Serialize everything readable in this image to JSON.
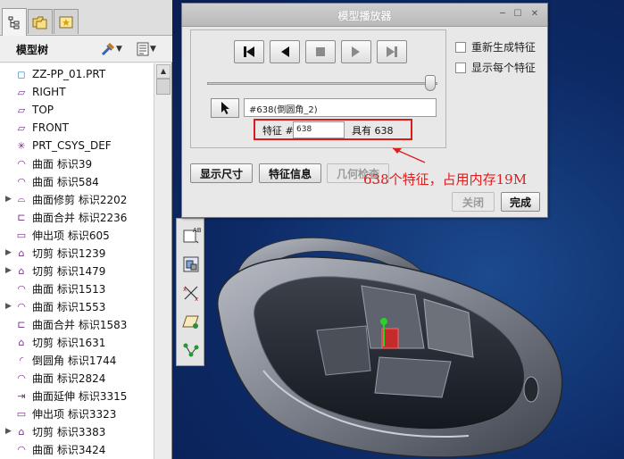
{
  "left_panel": {
    "tabs": [
      {
        "icon": "model-tree-tab-icon"
      },
      {
        "icon": "folder-browser-tab-icon"
      },
      {
        "icon": "favorites-tab-icon"
      }
    ],
    "tree_title": "模型树",
    "tree_items": [
      {
        "label": "ZZ-PP_01.PRT",
        "icon": "part-icon",
        "expand": false
      },
      {
        "label": "RIGHT",
        "icon": "datum-plane-icon",
        "expand": false
      },
      {
        "label": "TOP",
        "icon": "datum-plane-icon",
        "expand": false
      },
      {
        "label": "FRONT",
        "icon": "datum-plane-icon",
        "expand": false
      },
      {
        "label": "PRT_CSYS_DEF",
        "icon": "csys-icon",
        "expand": false
      },
      {
        "label": "曲面 标识39",
        "icon": "surface-icon",
        "expand": false
      },
      {
        "label": "曲面 标识584",
        "icon": "surface-icon",
        "expand": false
      },
      {
        "label": "曲面修剪 标识2202",
        "icon": "surface-trim-icon",
        "expand": true
      },
      {
        "label": "曲面合并 标识2236",
        "icon": "surface-merge-icon",
        "expand": false
      },
      {
        "label": "伸出项 标识605",
        "icon": "protrusion-icon",
        "expand": false
      },
      {
        "label": "切剪 标识1239",
        "icon": "cut-icon",
        "expand": true
      },
      {
        "label": "切剪 标识1479",
        "icon": "cut-icon",
        "expand": true
      },
      {
        "label": "曲面 标识1513",
        "icon": "surface-icon",
        "expand": false
      },
      {
        "label": "曲面 标识1553",
        "icon": "surface-icon",
        "expand": true
      },
      {
        "label": "曲面合并 标识1583",
        "icon": "surface-merge-icon",
        "expand": false
      },
      {
        "label": "切剪 标识1631",
        "icon": "cut-icon",
        "expand": false
      },
      {
        "label": "倒圆角 标识1744",
        "icon": "round-icon",
        "expand": false
      },
      {
        "label": "曲面 标识2824",
        "icon": "surface-icon",
        "expand": false
      },
      {
        "label": "曲面延伸 标识3315",
        "icon": "surface-extend-icon",
        "expand": false
      },
      {
        "label": "伸出项 标识3323",
        "icon": "protrusion-icon",
        "expand": false
      },
      {
        "label": "切剪 标识3383",
        "icon": "cut-icon",
        "expand": true
      },
      {
        "label": "曲面 标识3424",
        "icon": "surface-icon",
        "expand": false
      }
    ]
  },
  "dialog": {
    "title": "模型播放器",
    "player_buttons": [
      {
        "name": "first-feature-button",
        "icon": "skip-to-start-icon"
      },
      {
        "name": "step-back-button",
        "icon": "play-reverse-icon"
      },
      {
        "name": "stop-button",
        "icon": "stop-icon"
      },
      {
        "name": "step-forward-button",
        "icon": "play-icon"
      },
      {
        "name": "last-feature-button",
        "icon": "skip-to-end-icon"
      }
    ],
    "slider_position": 1.0,
    "feature_name": "#638(倒圆角_2)",
    "feature_label": "特征 #",
    "feature_number": "638",
    "total_label": "具有 638",
    "checkboxes": [
      {
        "label": "重新生成特征",
        "checked": false
      },
      {
        "label": "显示每个特征",
        "checked": false
      }
    ],
    "buttons": {
      "show_dims": "显示尺寸",
      "feature_info": "特征信息",
      "geometry_check": "几何检查",
      "close": "关闭",
      "done": "完成"
    }
  },
  "annotation": {
    "text": "638个特征，占用内存19M",
    "color": "#e21c1c"
  },
  "colors": {
    "background": "#0e2a66",
    "highlight": "#d91b1b"
  }
}
